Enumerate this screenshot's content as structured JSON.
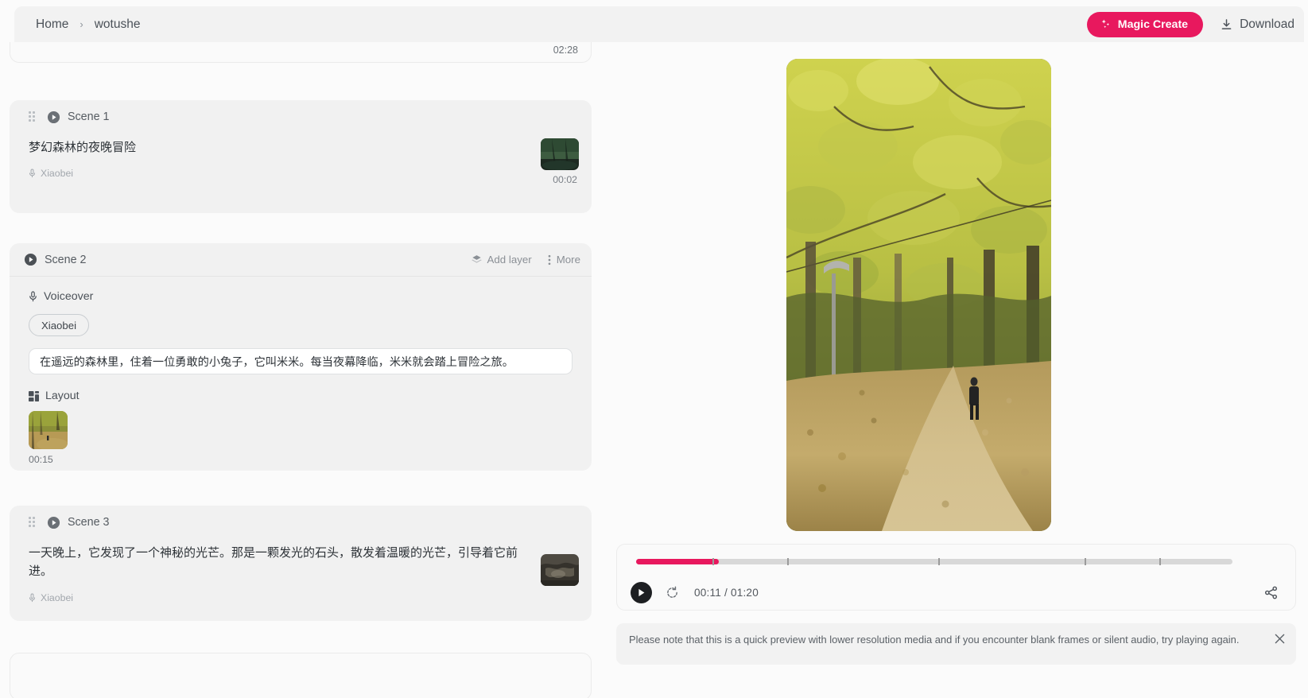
{
  "topbar": {
    "breadcrumb": {
      "home": "Home",
      "separator": "›",
      "current": "wotushe"
    },
    "magic_create_label": "Magic Create",
    "download_label": "Download",
    "accent_color": "#e8185e"
  },
  "scene_list": {
    "partial_card": {
      "duration": "02:28"
    },
    "scenes": [
      {
        "title": "Scene 1",
        "text": "梦幻森林的夜晚冒险",
        "voice": "Xiaobei",
        "duration": "00:02",
        "expanded": false
      },
      {
        "title": "Scene 2",
        "expanded": true,
        "add_layer_label": "Add layer",
        "more_label": "More",
        "voiceover_label": "Voiceover",
        "voice": "Xiaobei",
        "script": "在遥远的森林里，住着一位勇敢的小兔子，它叫米米。每当夜幕降临，米米就会踏上冒险之旅。",
        "layout_label": "Layout",
        "layout_duration": "00:15"
      },
      {
        "title": "Scene 3",
        "text": "一天晚上，它发现了一个神秘的光芒。那是一颗发光的石头，散发着温暖的光芒，引导着它前进。",
        "voice": "Xiaobei",
        "expanded": false
      }
    ]
  },
  "player": {
    "current_time": "00:11",
    "total_time": "01:20",
    "time_display": "00:11 / 01:20",
    "progress_percent": 13.8,
    "progress_color": "#e8185e",
    "track_color": "#d8d8d8"
  },
  "notice": {
    "message": "Please note that this is a quick preview with lower resolution media and if you encounter blank frames or silent audio, try playing again."
  },
  "icons": {
    "sparkle": "magic-sparkle-icon",
    "download": "download-icon",
    "play": "play-icon",
    "layers": "layers-icon",
    "more": "more-vertical-icon",
    "microphone": "microphone-icon",
    "layout_grid": "layout-grid-icon",
    "replay": "replay-icon",
    "share": "share-icon",
    "close": "close-icon",
    "drag": "drag-handle-icon"
  }
}
